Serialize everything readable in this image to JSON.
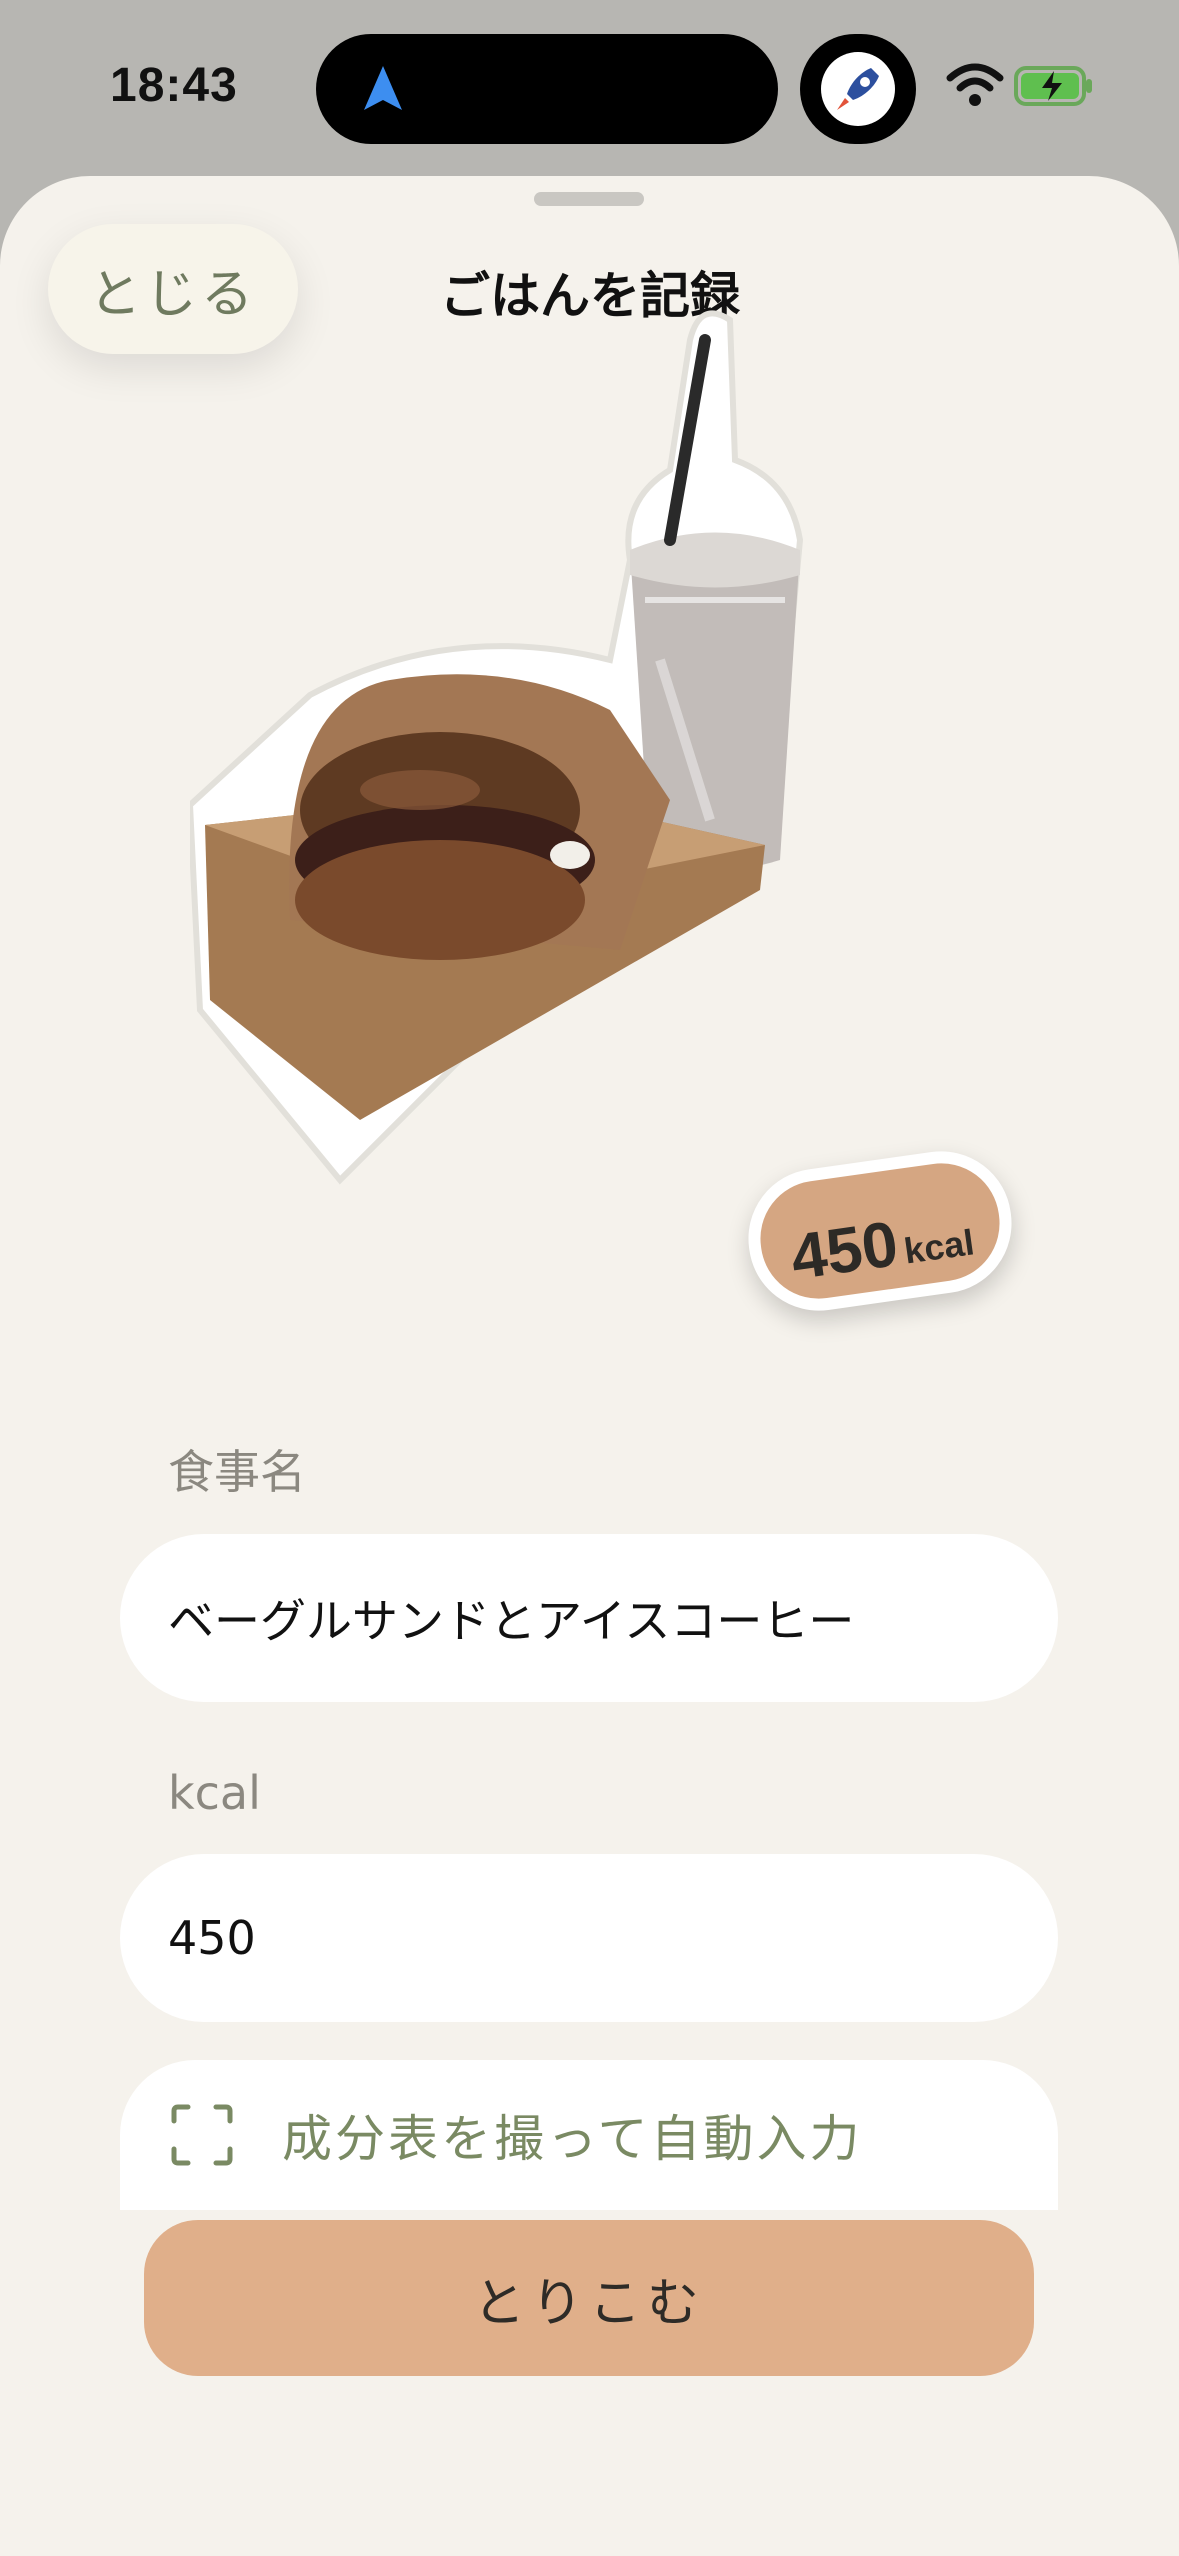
{
  "status_bar": {
    "time": "18:43"
  },
  "header": {
    "close_label": "とじる",
    "title": "ごはんを記録"
  },
  "photo": {
    "kcal_value": "450",
    "kcal_unit": "kcal"
  },
  "form": {
    "meal_name_label": "食事名",
    "meal_name_value": "ベーグルサンドとアイスコーヒー",
    "kcal_label": "kcal",
    "kcal_value": "450",
    "scan_label": "成分表を撮って自動入力"
  },
  "footer": {
    "import_label": "とりこむ"
  },
  "colors": {
    "sheet_bg": "#f5f2ec",
    "accent": "#e0af8a",
    "badge": "#d5a682",
    "secondary_text": "#7a8a63"
  }
}
